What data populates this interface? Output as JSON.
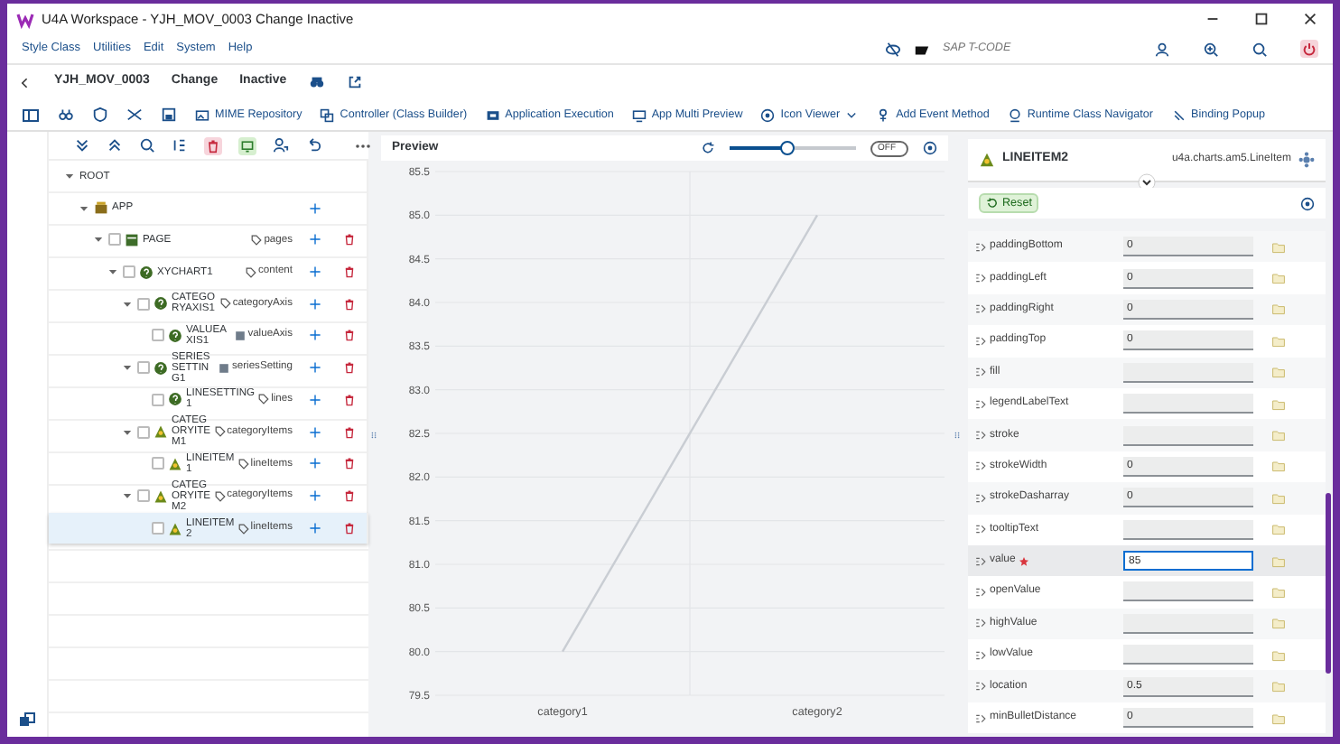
{
  "window": {
    "title": "U4A Workspace - YJH_MOV_0003 Change Inactive"
  },
  "menu": [
    "Style Class",
    "Utilities",
    "Edit",
    "System",
    "Help"
  ],
  "tcode": {
    "placeholder": "SAP T-CODE"
  },
  "object_bar": {
    "id": "YJH_MOV_0003",
    "mode": "Change",
    "status": "Inactive"
  },
  "toolbar": [
    {
      "label": "MIME Repository",
      "dropdown": false
    },
    {
      "label": "Controller (Class Builder)",
      "dropdown": false
    },
    {
      "label": "Application Execution",
      "dropdown": false
    },
    {
      "label": "App Multi Preview",
      "dropdown": false
    },
    {
      "label": "Icon Viewer",
      "dropdown": true
    },
    {
      "label": "Add Event Method",
      "dropdown": false
    },
    {
      "label": "Runtime Class Navigator",
      "dropdown": false
    },
    {
      "label": "Binding Popup",
      "dropdown": false
    }
  ],
  "tree": [
    {
      "name": "ROOT",
      "expanded": true,
      "checkable": false,
      "addable": false,
      "deletable": false,
      "selected": false,
      "children": [
        {
          "name": "APP",
          "kind": "app",
          "expanded": true,
          "checkable": false,
          "addable": true,
          "deletable": false,
          "selected": false,
          "children": [
            {
              "name": "PAGE",
              "kind": "page",
              "aggregation": {
                "label": "pages",
                "kind": "multiple"
              },
              "expanded": true,
              "checkable": true,
              "addable": true,
              "deletable": true,
              "selected": false,
              "children": [
                {
                  "name": "XYCHART1",
                  "kind": "control",
                  "aggregation": {
                    "label": "content",
                    "kind": "multiple"
                  },
                  "expanded": true,
                  "checkable": true,
                  "addable": true,
                  "deletable": true,
                  "selected": false,
                  "children": [
                    {
                      "name": "CATEGORYAXIS1",
                      "kind": "control",
                      "aggregation": {
                        "label": "categoryAxis",
                        "kind": "multiple"
                      },
                      "expanded": true,
                      "checkable": true,
                      "addable": true,
                      "deletable": true,
                      "selected": false,
                      "children": [
                        {
                          "name": "VALUEAXIS1",
                          "kind": "control",
                          "aggregation": {
                            "label": "valueAxis",
                            "kind": "single"
                          },
                          "checkable": true,
                          "addable": true,
                          "deletable": true,
                          "selected": false
                        }
                      ]
                    },
                    {
                      "name": "SERIESSETTING1",
                      "kind": "control",
                      "aggregation": {
                        "label": "seriesSetting",
                        "kind": "single"
                      },
                      "expanded": true,
                      "checkable": true,
                      "addable": true,
                      "deletable": true,
                      "selected": false,
                      "children": [
                        {
                          "name": "LINESETTING1",
                          "kind": "control",
                          "aggregation": {
                            "label": "lines",
                            "kind": "multiple"
                          },
                          "checkable": true,
                          "addable": true,
                          "deletable": true,
                          "selected": false
                        }
                      ]
                    },
                    {
                      "name": "CATEGORYITEM1",
                      "kind": "item",
                      "aggregation": {
                        "label": "categoryItems",
                        "kind": "multiple"
                      },
                      "expanded": true,
                      "checkable": true,
                      "addable": true,
                      "deletable": true,
                      "selected": false,
                      "children": [
                        {
                          "name": "LINEITEM1",
                          "kind": "item",
                          "aggregation": {
                            "label": "lineItems",
                            "kind": "multiple"
                          },
                          "checkable": true,
                          "addable": true,
                          "deletable": true,
                          "selected": false
                        }
                      ]
                    },
                    {
                      "name": "CATEGORYITEM2",
                      "kind": "item",
                      "aggregation": {
                        "label": "categoryItems",
                        "kind": "multiple"
                      },
                      "expanded": true,
                      "checkable": true,
                      "addable": true,
                      "deletable": true,
                      "selected": false,
                      "children": [
                        {
                          "name": "LINEITEM2",
                          "kind": "item",
                          "aggregation": {
                            "label": "lineItems",
                            "kind": "multiple"
                          },
                          "checkable": true,
                          "addable": true,
                          "deletable": true,
                          "selected": true
                        }
                      ]
                    }
                  ]
                }
              ]
            }
          ]
        }
      ]
    }
  ],
  "preview": {
    "title": "Preview",
    "zoom": {
      "level": 0.45
    },
    "toggle": {
      "label": "OFF",
      "on": false
    },
    "chart_data": {
      "type": "line",
      "categories": [
        "category1",
        "category2"
      ],
      "grid": true,
      "series": [
        {
          "color": "#c9cdd3",
          "values": [
            80,
            85
          ]
        }
      ],
      "ylim": [
        79.5,
        85.5
      ],
      "yticks": [
        {
          "value": 79.5,
          "label": "79.5"
        },
        {
          "value": 80,
          "label": "80.0"
        },
        {
          "value": 80.5,
          "label": "80.5"
        },
        {
          "value": 81,
          "label": "81.0"
        },
        {
          "value": 81.5,
          "label": "81.5"
        },
        {
          "value": 82,
          "label": "82.0"
        },
        {
          "value": 82.5,
          "label": "82.5"
        },
        {
          "value": 83,
          "label": "83.0"
        },
        {
          "value": 83.5,
          "label": "83.5"
        },
        {
          "value": 84,
          "label": "84.0"
        },
        {
          "value": 84.5,
          "label": "84.5"
        },
        {
          "value": 85,
          "label": "85.0"
        },
        {
          "value": 85.5,
          "label": "85.5"
        }
      ]
    }
  },
  "properties_panel": {
    "title": "LINEITEM2",
    "class_name": "u4a.charts.am5.LineItem",
    "reset": "Reset",
    "properties": [
      {
        "label": "paddingBottom",
        "value": "0",
        "required": false,
        "selected": false
      },
      {
        "label": "paddingLeft",
        "value": "0",
        "required": false,
        "selected": false
      },
      {
        "label": "paddingRight",
        "value": "0",
        "required": false,
        "selected": false
      },
      {
        "label": "paddingTop",
        "value": "0",
        "required": false,
        "selected": false
      },
      {
        "label": "fill",
        "required": false,
        "selected": false
      },
      {
        "label": "legendLabelText",
        "required": false,
        "selected": false
      },
      {
        "label": "stroke",
        "required": false,
        "selected": false
      },
      {
        "label": "strokeWidth",
        "value": "0",
        "required": false,
        "selected": false
      },
      {
        "label": "strokeDasharray",
        "value": "0",
        "required": false,
        "selected": false
      },
      {
        "label": "tooltipText",
        "required": false,
        "selected": false
      },
      {
        "label": "value",
        "value": "85",
        "required": true,
        "selected": true
      },
      {
        "label": "openValue",
        "required": false,
        "selected": false
      },
      {
        "label": "highValue",
        "required": false,
        "selected": false
      },
      {
        "label": "lowValue",
        "required": false,
        "selected": false
      },
      {
        "label": "location",
        "value": "0.5",
        "required": false,
        "selected": false
      },
      {
        "label": "minBulletDistance",
        "value": "0",
        "required": false,
        "selected": false
      }
    ]
  }
}
